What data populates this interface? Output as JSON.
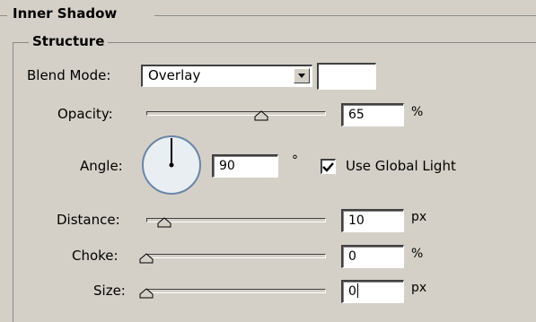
{
  "section_title": "Inner Shadow",
  "group_title": "Structure",
  "blend_mode": {
    "label": "Blend Mode:",
    "value": "Overlay",
    "color": "#ffffff"
  },
  "opacity": {
    "label": "Opacity:",
    "value": "65",
    "unit": "%",
    "level": 0.65
  },
  "angle": {
    "label": "Angle:",
    "value": "90",
    "unit": "°",
    "degrees": 90
  },
  "use_global_light": {
    "label": "Use Global Light",
    "checked": true
  },
  "distance": {
    "label": "Distance:",
    "value": "10",
    "unit": "px",
    "level": 0.04
  },
  "choke": {
    "label": "Choke:",
    "value": "0",
    "unit": "%",
    "level": 0.0
  },
  "size": {
    "label": "Size:",
    "value": "0",
    "unit": "px",
    "level": 0.0
  },
  "icons": {
    "dropdown": "chevron-down-icon",
    "checkbox": "checkmark-icon",
    "dial": "angle-dial-icon"
  }
}
